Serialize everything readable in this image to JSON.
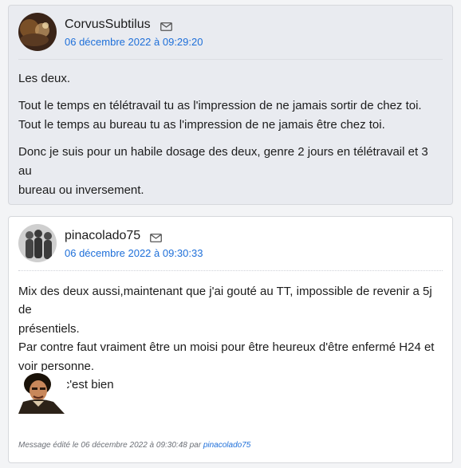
{
  "posts": [
    {
      "author": "CorvusSubtilus",
      "date": "06 décembre 2022 à 09:29:20",
      "paragraphs": [
        [
          "Les deux."
        ],
        [
          "Tout le temps en télétravail tu as l'impression de ne jamais sortir de chez toi.",
          "Tout le temps au bureau tu as l'impression de ne jamais être chez toi."
        ],
        [
          "Donc je suis pour un habile dosage des deux, genre 2 jours en télétravail et 3 au",
          "bureau ou inversement."
        ]
      ]
    },
    {
      "author": "pinacolado75",
      "date": "06 décembre 2022 à 09:30:33",
      "lines": [
        "Mix des deux aussi,maintenant que j'ai gouté au TT, impossible de revenir a 5j de",
        "présentiels.",
        "Par contre faut vraiment être un moisi pour être heureux d'être enfermé H24 et",
        "voir personne.",
        "Un 3 / 2 c'est bien"
      ],
      "edited_text": "Message édité le 06 décembre 2022 à 09:30:48 par ",
      "edited_by": "pinacolado75"
    }
  ],
  "icons": {
    "mail": "mail-icon"
  },
  "colors": {
    "link": "#1e6fd9",
    "post1_bg": "#e9ebf0",
    "post2_bg": "#ffffff"
  }
}
